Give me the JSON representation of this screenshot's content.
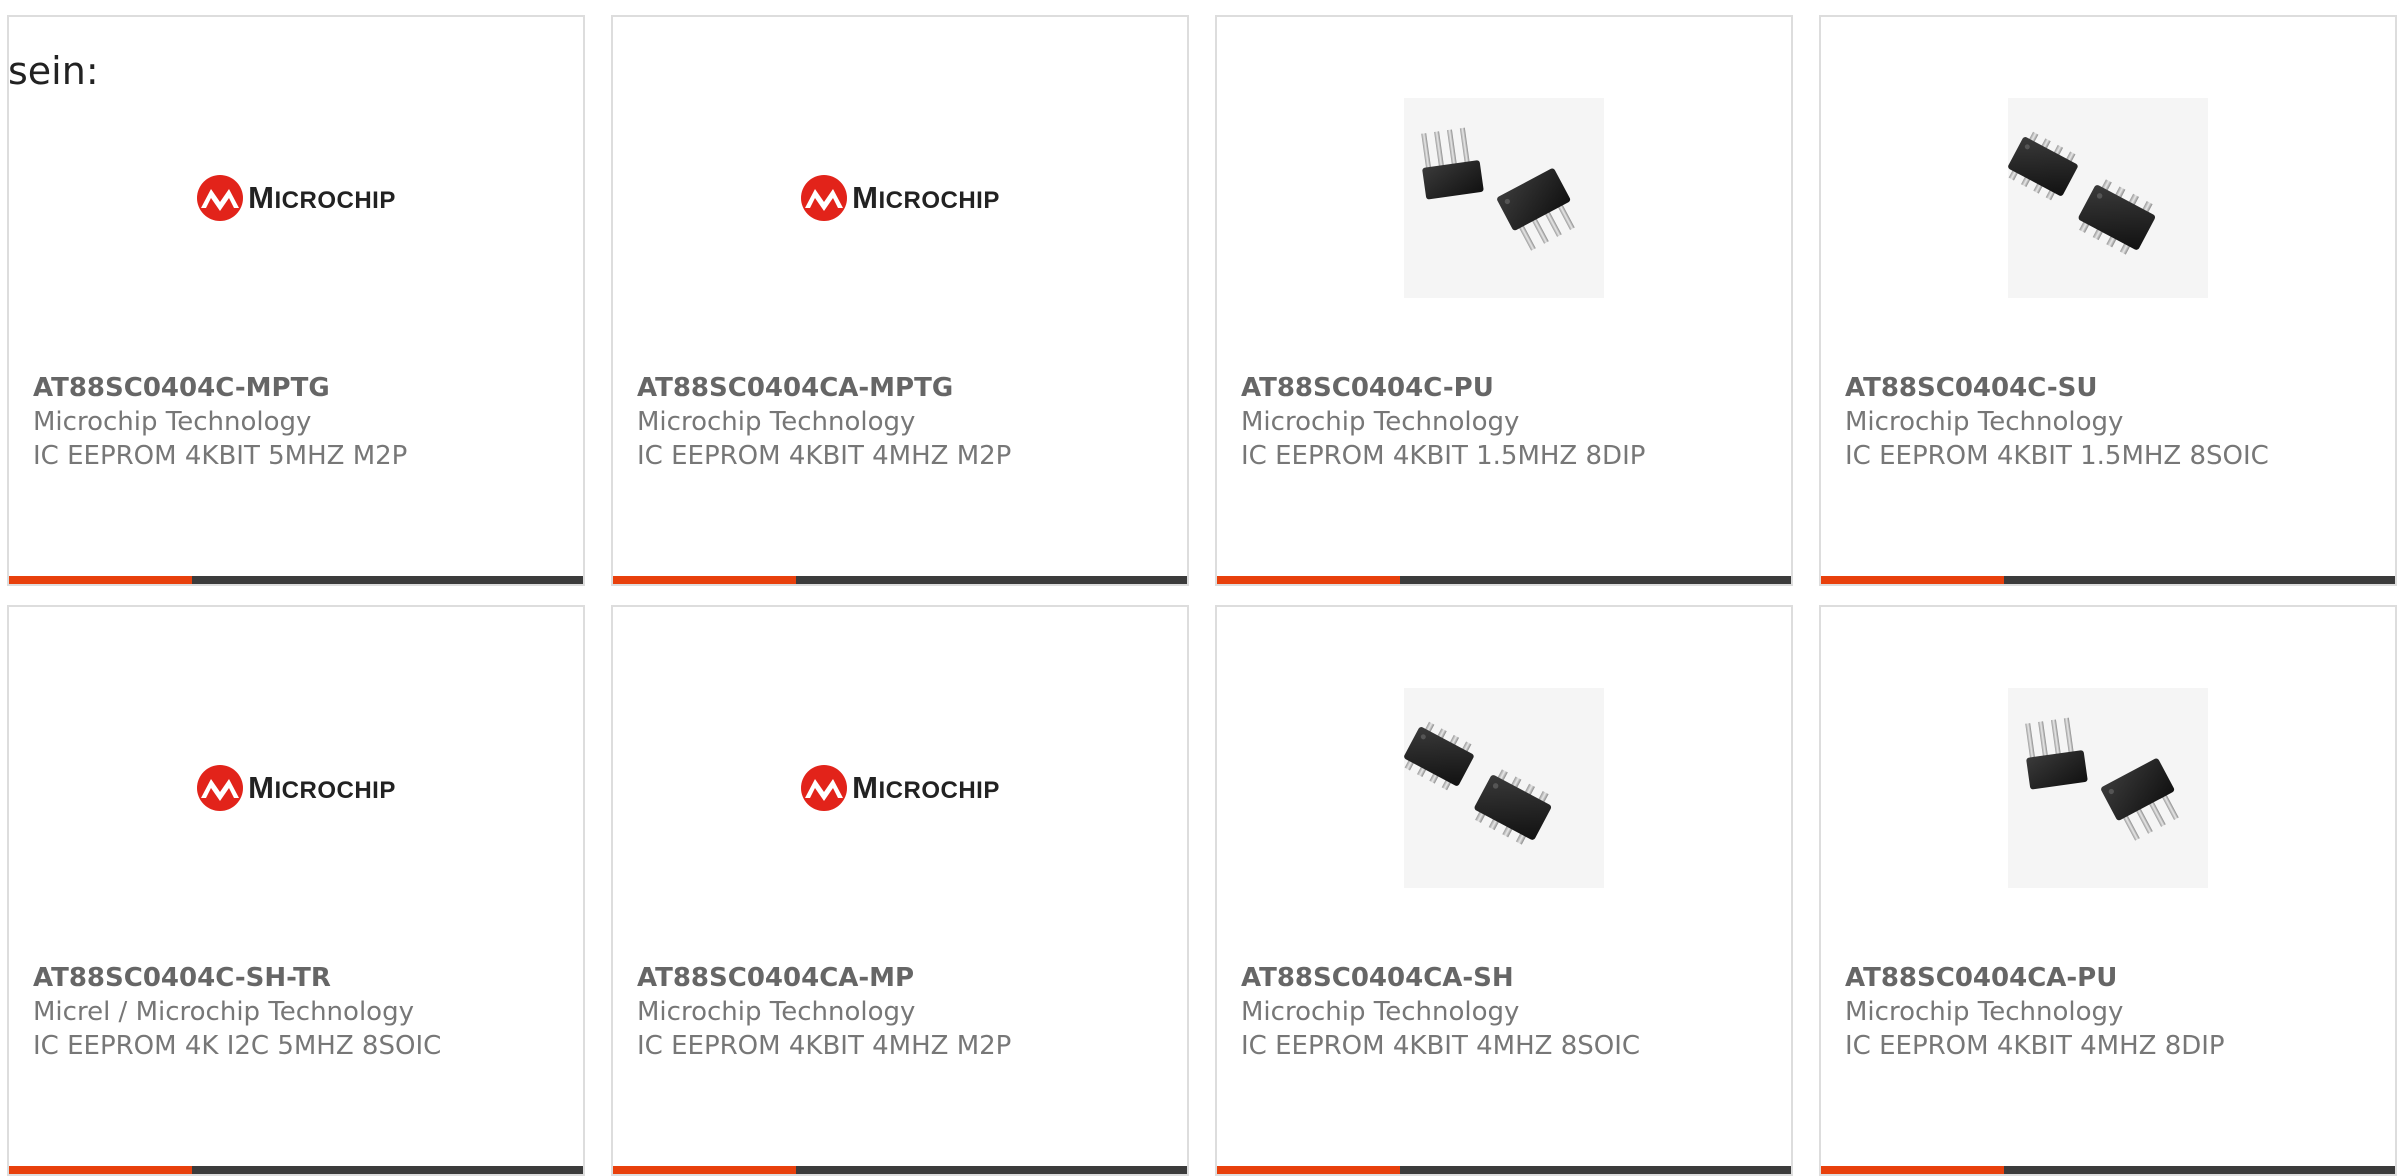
{
  "intro_text": "sein:",
  "brand": {
    "accent_color": "#e8400c",
    "bar_color": "#3b3b3b",
    "logo_red": "#e2231a"
  },
  "products": [
    {
      "part_number": "AT88SC0404C-MPTG",
      "manufacturer": "Microchip Technology",
      "description": "IC EEPROM 4KBIT 5MHZ M2P",
      "image": "microchip-logo",
      "logo_text": "Microchip"
    },
    {
      "part_number": "AT88SC0404CA-MPTG",
      "manufacturer": "Microchip Technology",
      "description": "IC EEPROM 4KBIT 4MHZ M2P",
      "image": "microchip-logo",
      "logo_text": "Microchip"
    },
    {
      "part_number": "AT88SC0404C-PU",
      "manufacturer": "Microchip Technology",
      "description": "IC EEPROM 4KBIT 1.5MHZ 8DIP",
      "image": "dip-package-photo"
    },
    {
      "part_number": "AT88SC0404C-SU",
      "manufacturer": "Microchip Technology",
      "description": "IC EEPROM 4KBIT 1.5MHZ 8SOIC",
      "image": "soic-package-photo"
    },
    {
      "part_number": "AT88SC0404C-SH-TR",
      "manufacturer": "Micrel / Microchip Technology",
      "description": "IC EEPROM 4K I2C 5MHZ 8SOIC",
      "image": "microchip-logo",
      "logo_text": "Microchip"
    },
    {
      "part_number": "AT88SC0404CA-MP",
      "manufacturer": "Microchip Technology",
      "description": "IC EEPROM 4KBIT 4MHZ M2P",
      "image": "microchip-logo",
      "logo_text": "Microchip"
    },
    {
      "part_number": "AT88SC0404CA-SH",
      "manufacturer": "Microchip Technology",
      "description": "IC EEPROM 4KBIT 4MHZ 8SOIC",
      "image": "soic-package-photo"
    },
    {
      "part_number": "AT88SC0404CA-PU",
      "manufacturer": "Microchip Technology",
      "description": "IC EEPROM 4KBIT 4MHZ 8DIP",
      "image": "dip-package-photo"
    }
  ]
}
